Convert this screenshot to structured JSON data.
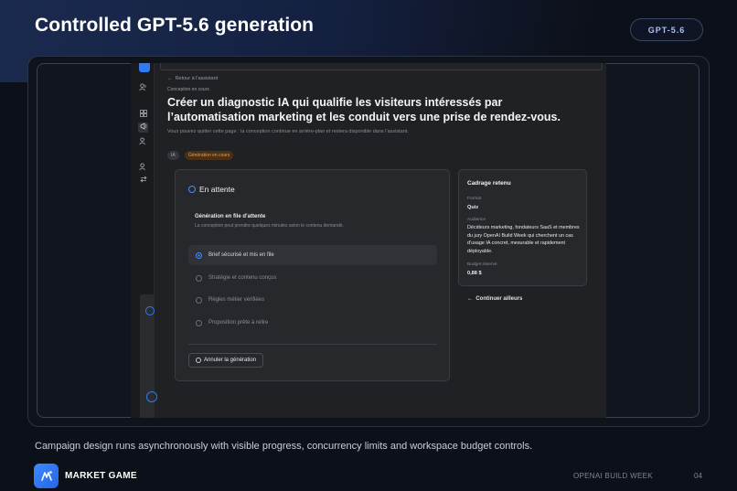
{
  "slide": {
    "title": "Controlled GPT-5.6 generation",
    "model_pill": "GPT-5.6",
    "caption": "Campaign design runs asynchronously with visible progress, concurrency limits and workspace budget controls.",
    "brand_name": "MARKET GAME",
    "event": "OPENAI BUILD WEEK",
    "page_number": "04"
  },
  "app": {
    "back_link": "Retour à l'assistant",
    "breadcrumb": "Conception en cours",
    "headline": "Créer un diagnostic IA qui qualifie les visiteurs intéressés par l’automatisation marketing et les conduit vers une prise de rendez-vous.",
    "subtext": "Vous pouvez quitter cette page : la conception continue en arrière-plan et restera disponible dans l’assistant.",
    "tags": [
      "IA",
      "Génération en cours"
    ],
    "status_card": {
      "title": "En attente",
      "queue_title": "Génération en file d’attente",
      "queue_sub": "La conception peut prendre quelques minutes selon le contenu demandé.",
      "steps": [
        {
          "label": "Brief sécurisé et mis en file",
          "active": true
        },
        {
          "label": "Stratégie et contenu conçus",
          "active": false
        },
        {
          "label": "Règles métier vérifiées",
          "active": false
        },
        {
          "label": "Proposition prête à relire",
          "active": false
        }
      ],
      "cancel_label": "Annuler la génération"
    },
    "summary_card": {
      "title": "Cadrage retenu",
      "format_label": "Format",
      "format_value": "Quiz",
      "audience_label": "Audience",
      "audience_value": "Décideurs marketing, fondateurs SaaS et membres du jury OpenAI Build Week qui cherchent un cas d’usage IA concret, mesurable et rapidement déployable.",
      "budget_label": "Budget réservé",
      "budget_value": "0,88 $"
    },
    "continue_label": "Continuer ailleurs"
  },
  "colors": {
    "accent": "#2f7cf0",
    "warning_tag": "#e3a05a"
  }
}
